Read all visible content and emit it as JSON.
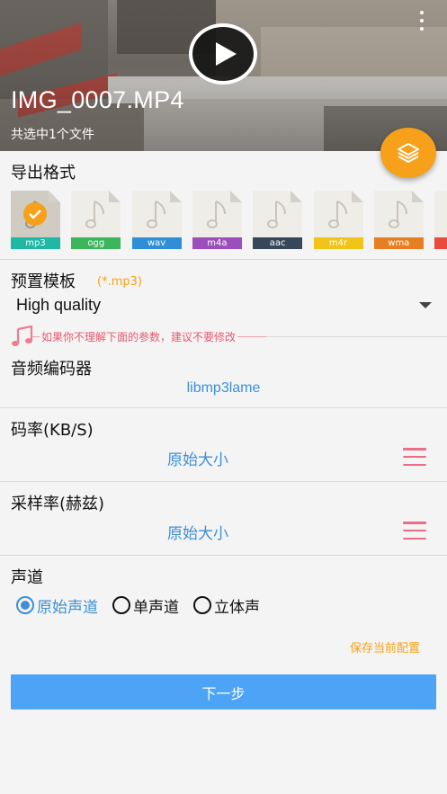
{
  "header": {
    "file_name": "IMG_0007.MP4",
    "selection_text": "共选中1个文件"
  },
  "export_format": {
    "title": "导出格式",
    "formats": [
      {
        "label": "mp3",
        "color": "#1fb8a2",
        "selected": true
      },
      {
        "label": "ogg",
        "color": "#3cb65a",
        "selected": false
      },
      {
        "label": "wav",
        "color": "#2f8fd6",
        "selected": false
      },
      {
        "label": "m4a",
        "color": "#9b4fba",
        "selected": false
      },
      {
        "label": "aac",
        "color": "#37475a",
        "selected": false
      },
      {
        "label": "m4r",
        "color": "#f0c419",
        "selected": false
      },
      {
        "label": "wma",
        "color": "#e67e22",
        "selected": false
      }
    ]
  },
  "preset": {
    "title": "预置模板",
    "hint": "(*.mp3)",
    "value": "High quality"
  },
  "warning": "如果你不理解下面的参数，建议不要修改",
  "codec": {
    "title": "音频编码器",
    "value": "libmp3lame"
  },
  "bitrate": {
    "title": "码率(KB/S)",
    "value": "原始大小"
  },
  "samplerate": {
    "title": "采样率(赫兹)",
    "value": "原始大小"
  },
  "channel": {
    "title": "声道",
    "options": [
      {
        "label": "原始声道",
        "selected": true
      },
      {
        "label": "单声道",
        "selected": false
      },
      {
        "label": "立体声",
        "selected": false
      }
    ]
  },
  "save_config_label": "保存当前配置",
  "next_label": "下一步",
  "colors": {
    "accent_orange": "#f7a019",
    "accent_blue": "#3d8fd8",
    "button_blue": "#4da3f5",
    "menu_pink": "#ea6f86"
  }
}
